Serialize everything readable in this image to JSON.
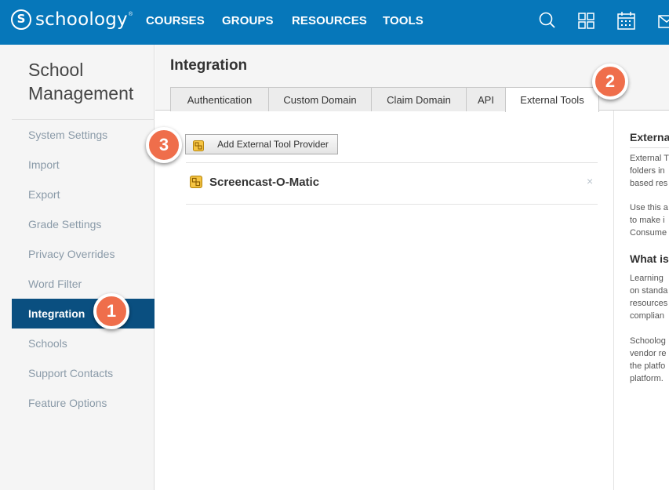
{
  "brand": {
    "logo_letter": "S",
    "name": "schoology",
    "tm": "®"
  },
  "nav": {
    "items": [
      "COURSES",
      "GROUPS",
      "RESOURCES",
      "TOOLS"
    ]
  },
  "top_icons": [
    "search-icon",
    "apps-grid-icon",
    "calendar-icon",
    "mail-icon"
  ],
  "sidebar": {
    "title_line1": "School",
    "title_line2": "Management",
    "items": [
      {
        "label": "System Settings"
      },
      {
        "label": "Import"
      },
      {
        "label": "Export"
      },
      {
        "label": "Grade Settings"
      },
      {
        "label": "Privacy Overrides"
      },
      {
        "label": "Word Filter"
      },
      {
        "label": "Integration",
        "active": true
      },
      {
        "label": "Schools"
      },
      {
        "label": "Support Contacts"
      },
      {
        "label": "Feature Options"
      }
    ]
  },
  "main": {
    "title": "Integration",
    "tabs": [
      {
        "label": "Authentication"
      },
      {
        "label": "Custom Domain"
      },
      {
        "label": "Claim Domain"
      },
      {
        "label": "API"
      },
      {
        "label": "External Tools",
        "active": true
      }
    ],
    "add_button": "Add External Tool Provider",
    "tools": [
      {
        "name": "Screencast-O-Matic",
        "remove": "×"
      }
    ]
  },
  "right_panel": {
    "heading1": "Externa",
    "para1": [
      "External T",
      "folders in",
      "based res"
    ],
    "para2": [
      "Use this a",
      "to make i",
      "Consume"
    ],
    "heading2": "What is",
    "para3": [
      "Learning",
      "on standa",
      "resources",
      "complian"
    ],
    "para4": [
      "Schoolog",
      "vendor re",
      "the platfo",
      "platform."
    ]
  },
  "callouts": [
    "1",
    "2",
    "3"
  ],
  "colors": {
    "topbar": "#0677ba",
    "active_sidebar": "#0a4f80",
    "callout": "#ef6e4b"
  }
}
